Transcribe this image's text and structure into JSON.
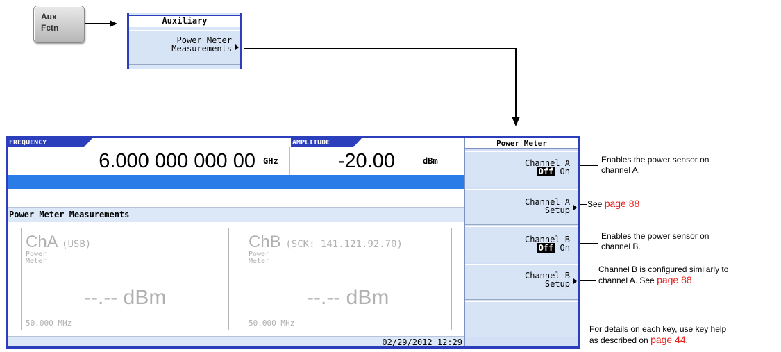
{
  "hardkey": {
    "line1": "Aux",
    "line2": "Fctn"
  },
  "aux_menu": {
    "title": "Auxiliary",
    "key_line1": "Power Meter",
    "key_line2": "Measurements"
  },
  "screen": {
    "frequency_label": "FREQUENCY",
    "frequency_value": "6.000 000 000 00",
    "frequency_unit": "GHz",
    "amplitude_label": "AMPLITUDE",
    "amplitude_value": "-20.00",
    "amplitude_unit": "dBm",
    "section_title": "Power Meter Measurements",
    "channel_a": {
      "name": "ChA",
      "conn": "(USB)",
      "label1": "Power",
      "label2": "Meter",
      "reading": "--.-- dBm",
      "freq": "50.000 MHz"
    },
    "channel_b": {
      "name": "ChB",
      "conn": "(SCK: 141.121.92.70)",
      "label1": "Power",
      "label2": "Meter",
      "reading": "--.-- dBm",
      "freq": "50.000 MHz"
    },
    "datetime": "02/29/2012 12:29"
  },
  "softkeys": {
    "title": "Power Meter",
    "channel_a": {
      "line1": "Channel A",
      "off": "Off",
      "on": "On"
    },
    "channel_a_setup": {
      "line1": "Channel A",
      "line2": "Setup"
    },
    "channel_b": {
      "line1": "Channel B",
      "off": "Off",
      "on": "On"
    },
    "channel_b_setup": {
      "line1": "Channel B",
      "line2": "Setup"
    }
  },
  "notes": {
    "n1_line1": "Enables the power sensor on",
    "n1_line2": "channel A.",
    "n2_prefix": "See ",
    "n2_link": "page 88",
    "n3_line1": "Enables the power sensor on",
    "n3_line2": "channel B.",
    "n4_line1": "Channel B is configured similarly to",
    "n4_line2_prefix": "channel A. See ",
    "n4_link": "page 88",
    "n5_line1": "For details on each key, use key help",
    "n5_line2_prefix": "as described on ",
    "n5_link": "page 44",
    "n5_suffix": "."
  }
}
